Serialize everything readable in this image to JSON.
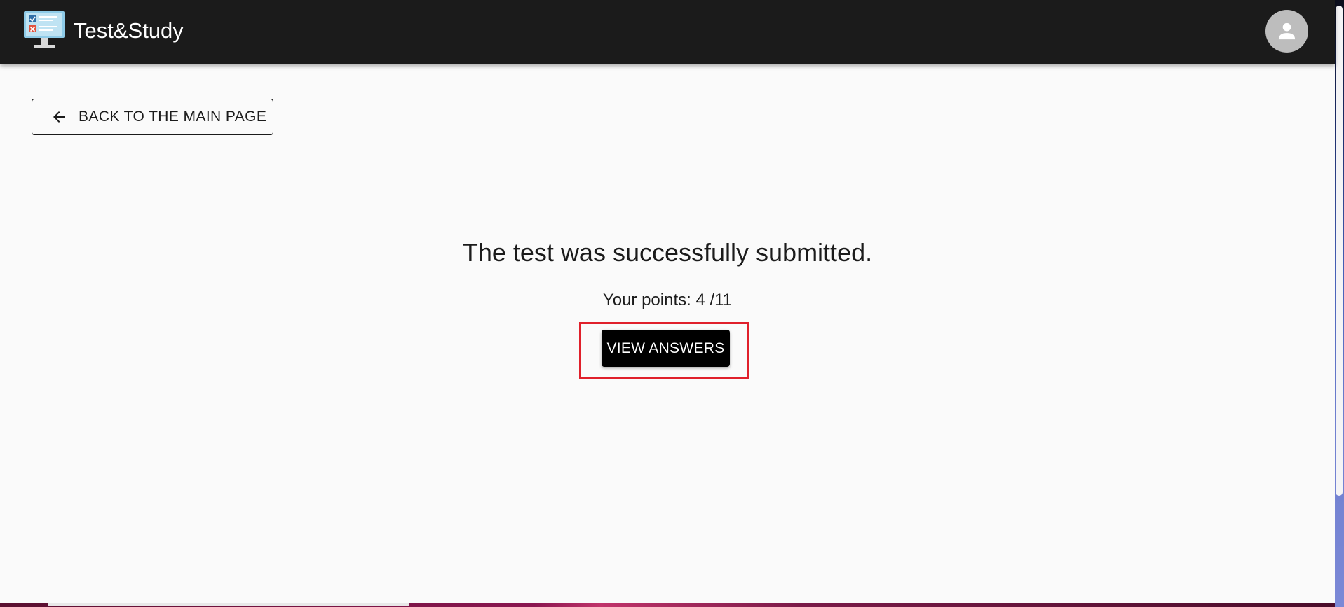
{
  "app": {
    "title": "Test&Study"
  },
  "navigation": {
    "back_label": "BACK TO THE MAIN PAGE"
  },
  "result": {
    "heading": "The test was successfully submitted.",
    "points_text": "Your points: 4 /11",
    "view_answers_label": "VIEW ANSWERS"
  },
  "icons": {
    "logo": "monitor-checklist-icon",
    "avatar": "person-icon",
    "back": "arrow-left-icon"
  },
  "colors": {
    "app_bar": "#1b1b1b",
    "background": "#fafafa",
    "primary_button": "#000000",
    "highlight": "#e0202b"
  }
}
